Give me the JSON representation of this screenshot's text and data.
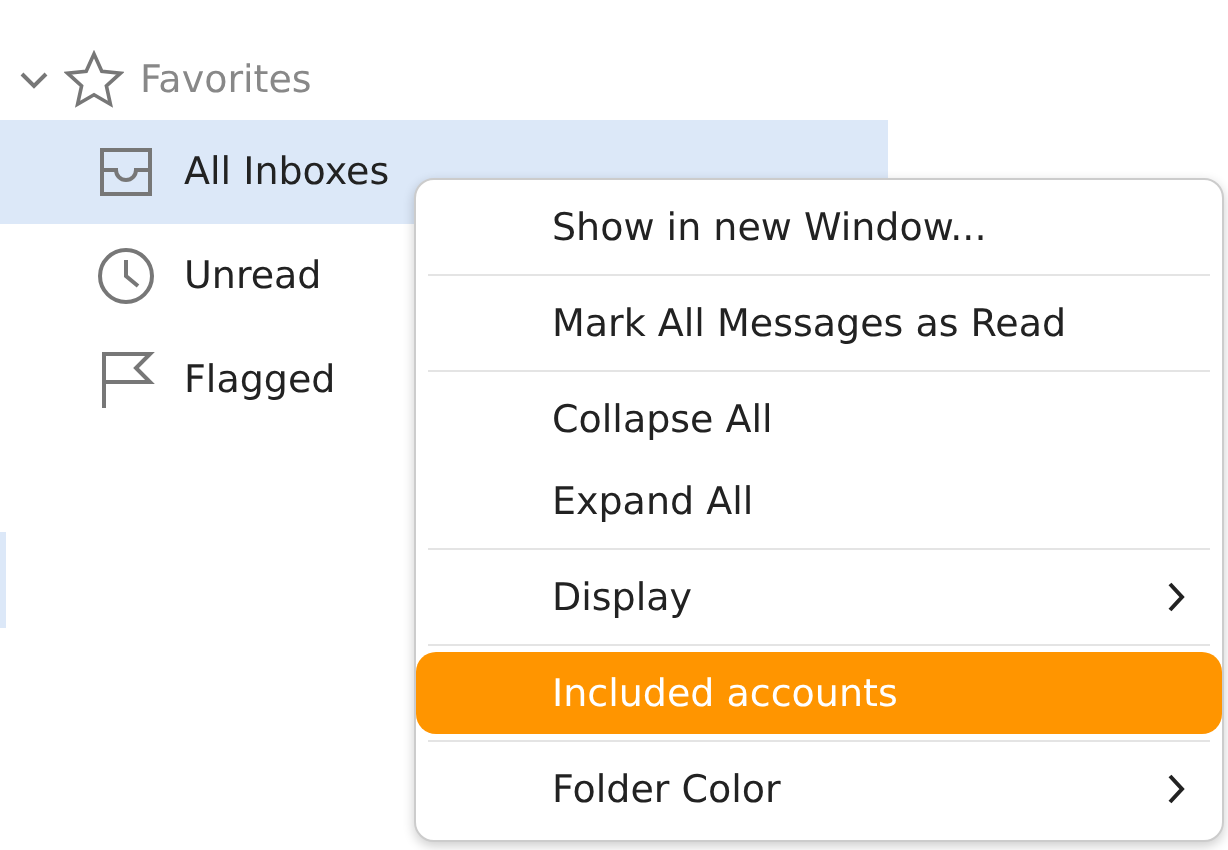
{
  "sidebar": {
    "section": {
      "label": "Favorites",
      "expanded": true
    },
    "items": [
      {
        "label": "All Inboxes",
        "selected": true
      },
      {
        "label": "Unread",
        "selected": false
      },
      {
        "label": "Flagged",
        "selected": false
      }
    ]
  },
  "context_menu": {
    "groups": [
      [
        {
          "label": "Show in new Window...",
          "submenu": false,
          "selected": false
        }
      ],
      [
        {
          "label": "Mark All Messages as Read",
          "submenu": false,
          "selected": false
        }
      ],
      [
        {
          "label": "Collapse All",
          "submenu": false,
          "selected": false
        },
        {
          "label": "Expand All",
          "submenu": false,
          "selected": false
        }
      ],
      [
        {
          "label": "Display",
          "submenu": true,
          "selected": false
        }
      ],
      [
        {
          "label": "Included accounts",
          "submenu": false,
          "selected": true
        }
      ],
      [
        {
          "label": "Folder Color",
          "submenu": true,
          "selected": false
        }
      ]
    ]
  }
}
